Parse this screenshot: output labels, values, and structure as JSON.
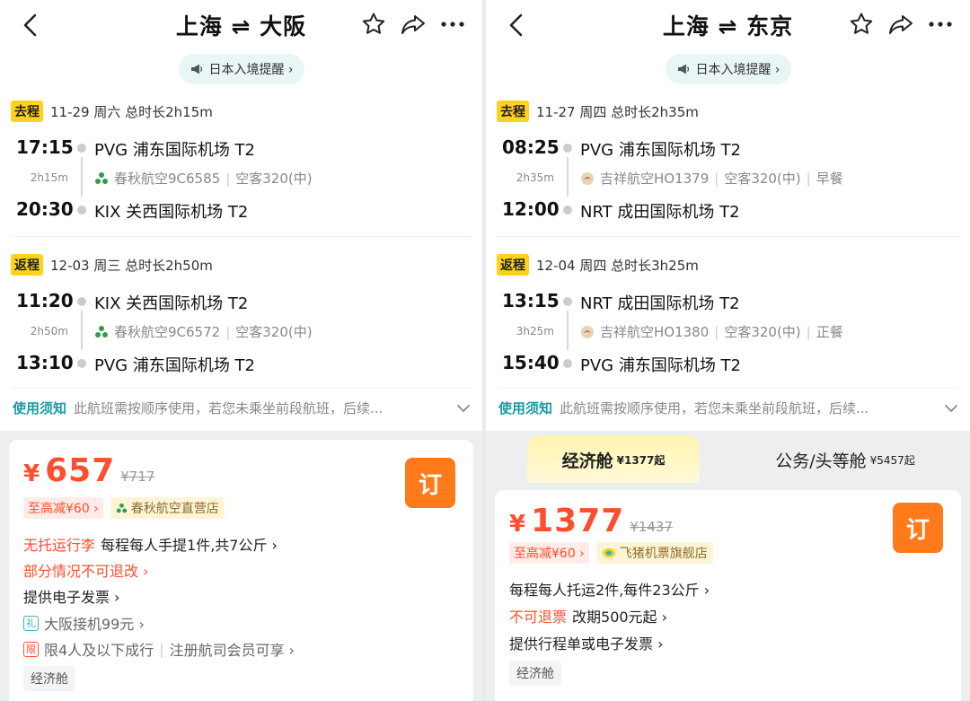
{
  "left": {
    "title": "上海 ⇌ 大阪",
    "notice": "日本入境提醒 ›",
    "outbound": {
      "tag": "去程",
      "summary": "11-29  周六  总时长2h15m",
      "dep_time": "17:15",
      "dep_airport": "PVG 浦东国际机场 T2",
      "duration": "2h15m",
      "airline": "春秋航空9C6585",
      "aircraft": "空客320(中)",
      "arr_time": "20:30",
      "arr_airport": "KIX 关西国际机场 T2"
    },
    "return": {
      "tag": "返程",
      "summary": "12-03  周三  总时长2h50m",
      "dep_time": "11:20",
      "dep_airport": "KIX 关西国际机场 T2",
      "duration": "2h50m",
      "airline": "春秋航空9C6572",
      "aircraft": "空客320(中)",
      "arr_time": "13:10",
      "arr_airport": "PVG 浦东国际机场 T2"
    },
    "usage_label": "使用须知",
    "usage_text": "此航班需按顺序使用，若您未乘坐前段航班，后续...",
    "card": {
      "yen": "¥",
      "price": "657",
      "old_price": "¥717",
      "book": "订",
      "discount": "至高减¥60 ›",
      "shop": "春秋航空直营店",
      "baggage_red": "无托运行李",
      "baggage_rest": "每程每人手提1件,共7公斤 ›",
      "refund": "部分情况不可退改 ›",
      "invoice": "提供电子发票 ›",
      "gift_icon": "礼",
      "gift": "大阪接机99元 ›",
      "limit_icon": "限",
      "limit": "限4人及以下成行",
      "member": "注册航司会员可享 ›",
      "cabin": "经济舱"
    }
  },
  "right": {
    "title": "上海 ⇌ 东京",
    "notice": "日本入境提醒 ›",
    "outbound": {
      "tag": "去程",
      "summary": "11-27  周四  总时长2h35m",
      "dep_time": "08:25",
      "dep_airport": "PVG 浦东国际机场 T2",
      "duration": "2h35m",
      "airline": "吉祥航空HO1379",
      "aircraft": "空客320(中)",
      "meal": "早餐",
      "arr_time": "12:00",
      "arr_airport": "NRT 成田国际机场 T2"
    },
    "return": {
      "tag": "返程",
      "summary": "12-04  周四  总时长3h25m",
      "dep_time": "13:15",
      "dep_airport": "NRT 成田国际机场 T2",
      "duration": "3h25m",
      "airline": "吉祥航空HO1380",
      "aircraft": "空客320(中)",
      "meal": "正餐",
      "arr_time": "15:40",
      "arr_airport": "PVG 浦东国际机场 T2"
    },
    "usage_label": "使用须知",
    "usage_text": "此航班需按顺序使用，若您未乘坐前段航班，后续...",
    "tabs": {
      "economy": "经济舱",
      "economy_price": "¥1377起",
      "business": "公务/头等舱",
      "business_price": "¥5457起"
    },
    "card": {
      "yen": "¥",
      "price": "1377",
      "old_price": "¥1437",
      "book": "订",
      "discount": "至高减¥60 ›",
      "shop": "飞猪机票旗舰店",
      "baggage": "每程每人托运2件,每件23公斤 ›",
      "refund_red": "不可退票",
      "change": "改期500元起 ›",
      "invoice": "提供行程单或电子发票 ›",
      "cabin": "经济舱"
    }
  },
  "colors": {
    "accent_orange": "#ff7a1a",
    "price_red": "#ff4d2e",
    "tag_yellow": "#ffd21e",
    "teal": "#1a9aa3"
  }
}
